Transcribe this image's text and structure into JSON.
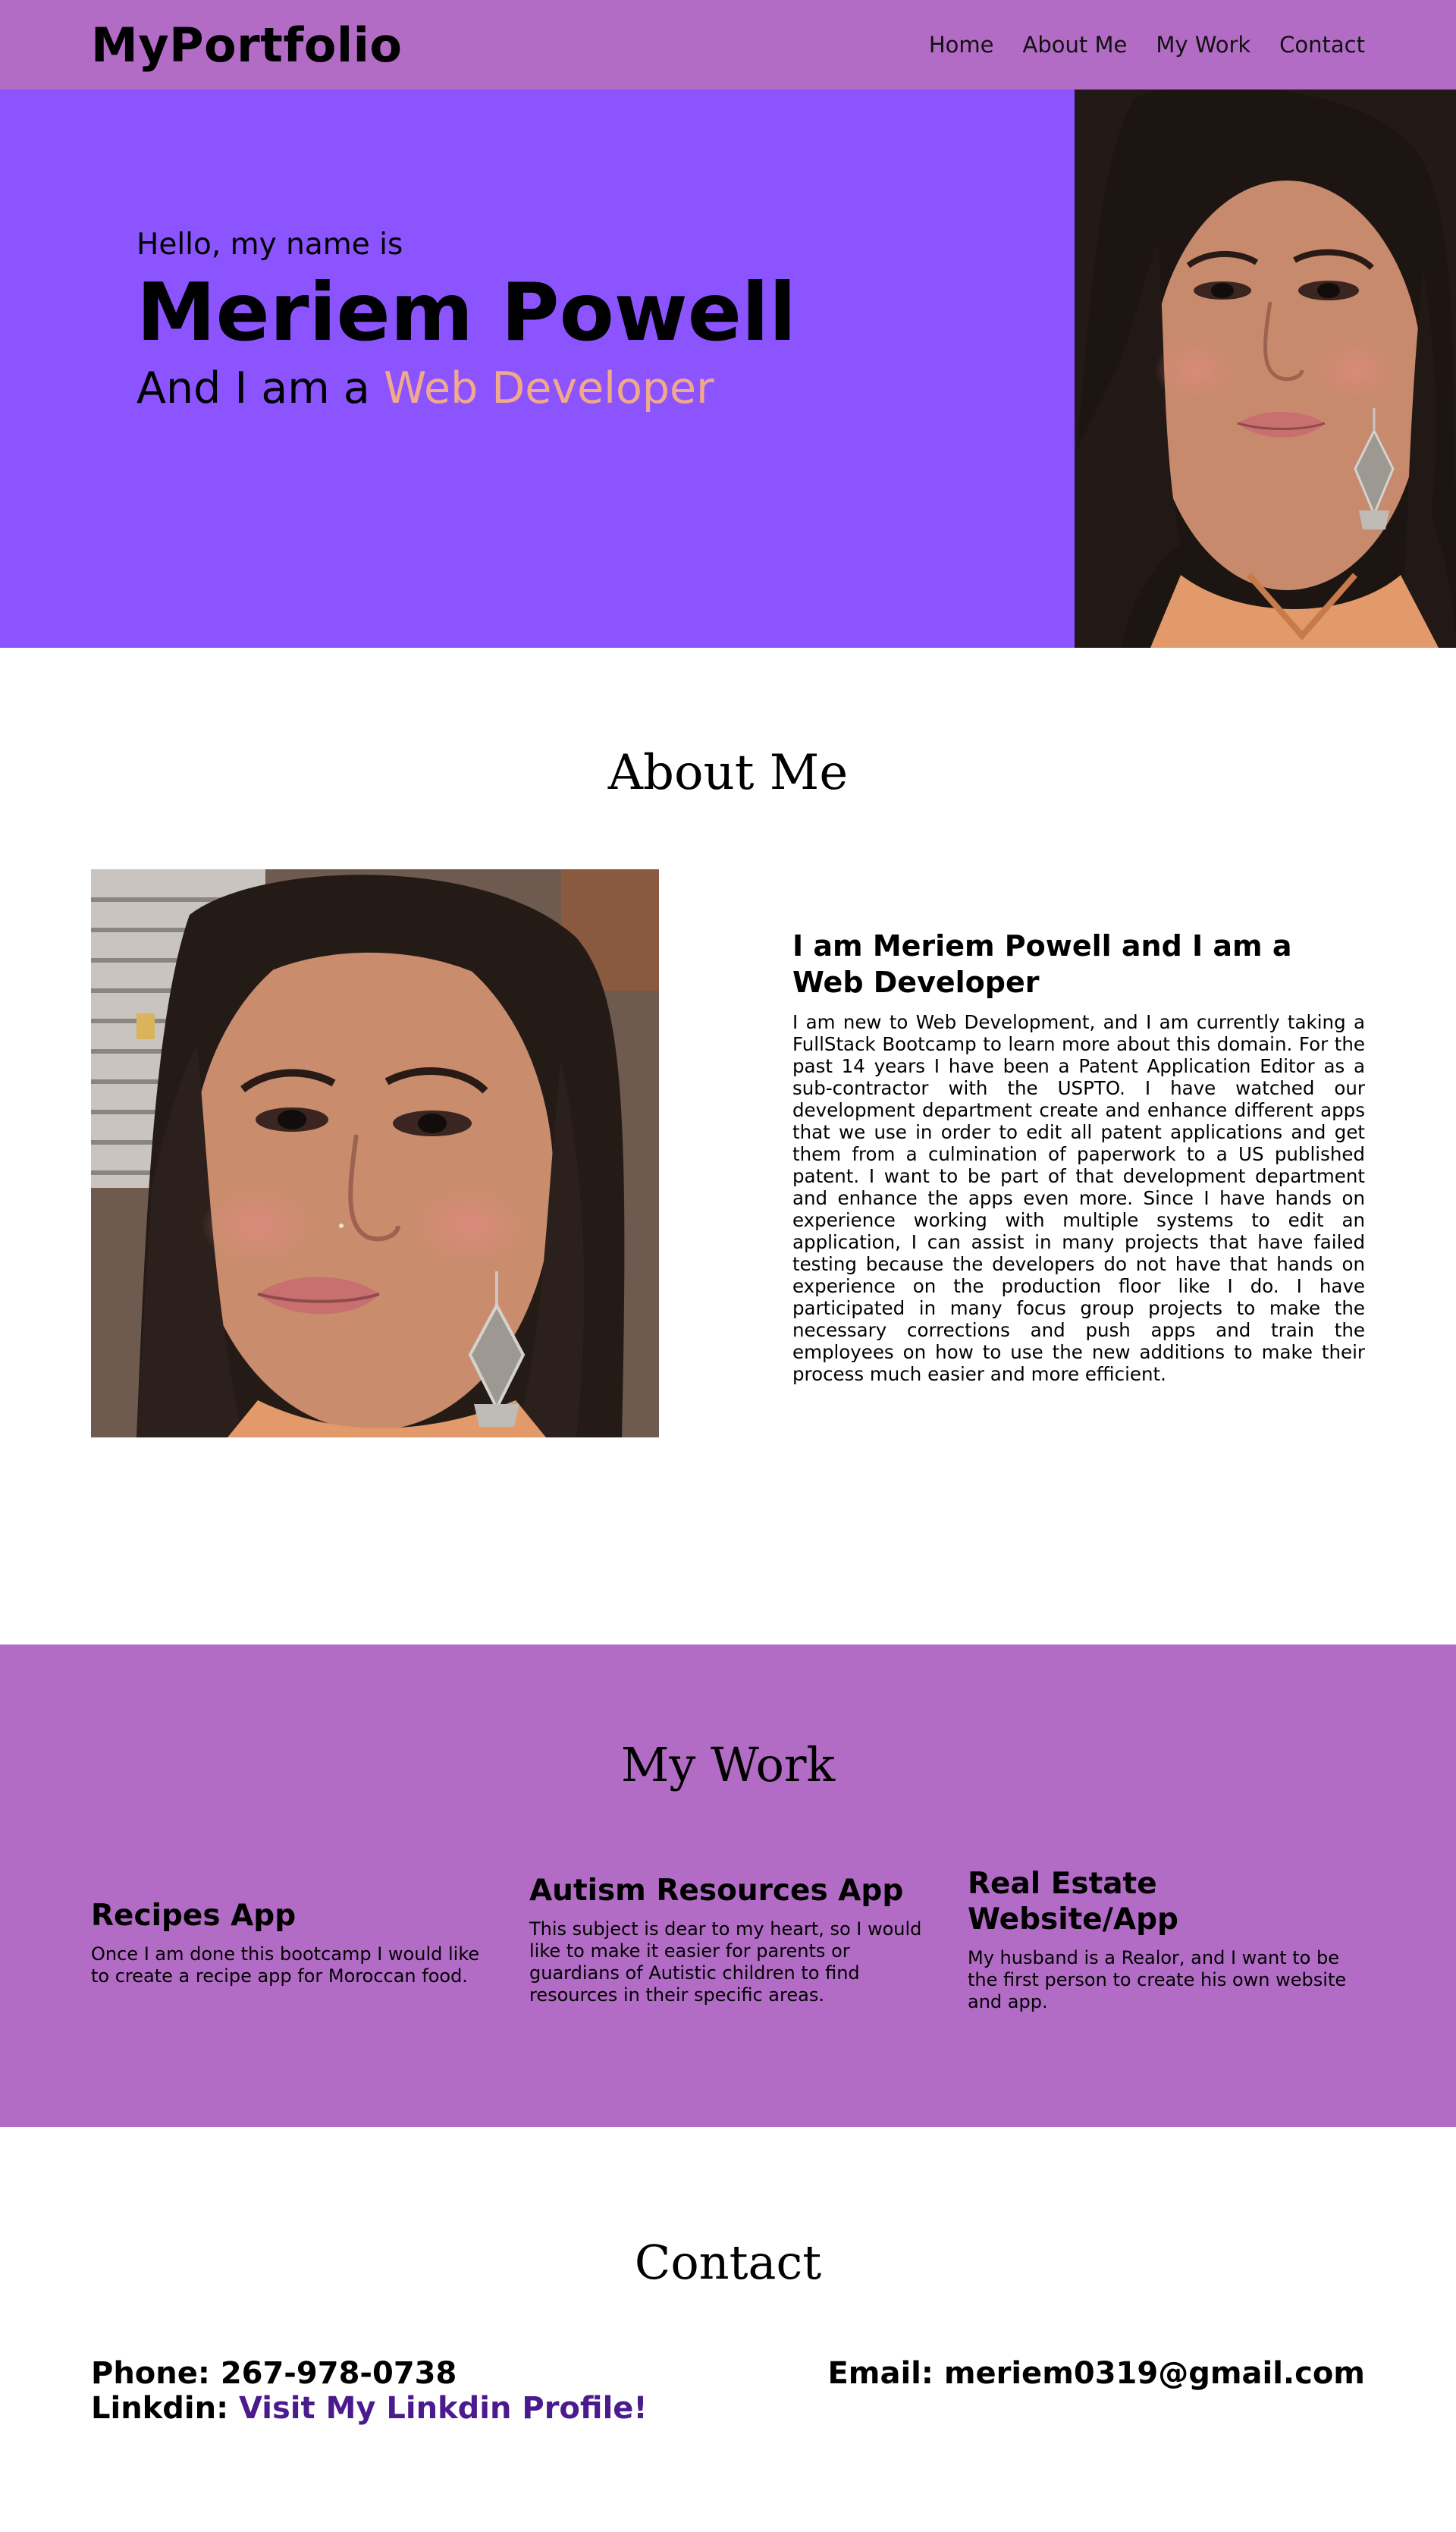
{
  "header": {
    "brand": "MyPortfolio",
    "nav": [
      "Home",
      "About Me",
      "My Work",
      "Contact"
    ]
  },
  "hero": {
    "greeting": "Hello, my name is",
    "name": "Meriem Powell",
    "role_prefix": "And I am a",
    "role_highlight": "Web Developer",
    "photo_alt": "Portrait of Meriem Powell"
  },
  "about": {
    "title": "About Me",
    "heading": "I am Meriem Powell and I am a Web Developer",
    "paragraph": "I am new to Web Development, and I am currently taking a FullStack Bootcamp to learn more about this domain. For the past 14 years I have been a Patent Application Editor as a sub-contractor with the USPTO. I have watched our development department create and enhance different apps that we use in order to edit all patent applications and get them from a culmination of paperwork to a US published patent. I want to be part of that development department and enhance the apps even more. Since I have hands on experience working with multiple systems to edit an application, I can assist in many projects that have failed testing because the developers do not have that hands on experience on the production floor like I do. I have participated in many focus group projects to make the necessary corrections and push apps and train the employees on how to use the new additions to make their process much easier and more efficient.",
    "photo_alt": "Photo of Meriem Powell"
  },
  "work": {
    "title": "My Work",
    "items": [
      {
        "title": "Recipes App",
        "desc": "Once I am done this bootcamp I would like to create a recipe app for Moroccan food."
      },
      {
        "title": "Autism Resources App",
        "desc": "This subject is dear to my heart, so I would like to make it easier for parents or guardians of Autistic children to find resources in their specific areas."
      },
      {
        "title": "Real Estate Website/App",
        "desc": "My husband is a Realor, and I want to be the first person to create his own website and app."
      }
    ]
  },
  "contact": {
    "title": "Contact",
    "phone_label": "Phone:",
    "phone": "267-978-0738",
    "linkedin_label": "Linkdin:",
    "linkedin_link": "Visit My Linkdin Profile!",
    "email_label": "Email:",
    "email": "meriem0319@gmail.com"
  },
  "colors": {
    "header_bg": "#b26cc5",
    "hero_bg": "#8c54ff",
    "accent": "#f2a98a",
    "link": "#4b1a8e"
  }
}
